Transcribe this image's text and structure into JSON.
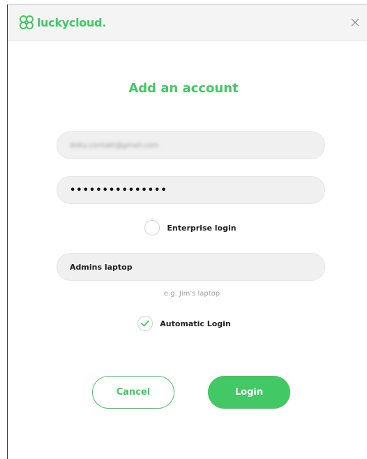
{
  "app": {
    "brand": "luckycloud",
    "brand_color": "#42c864"
  },
  "dialog": {
    "title": "Add an account",
    "email_value": "doku.contakt@gmail.com",
    "password_value": "•••••••••••••••",
    "enterprise_label": "Enterprise login",
    "enterprise_checked": false,
    "device_name_value": "Admins laptop",
    "device_name_hint": "e.g. Jim's laptop",
    "auto_login_label": "Automatic Login",
    "auto_login_checked": true,
    "cancel_label": "Cancel",
    "login_label": "Login"
  },
  "icons": {
    "logo": "luckycloud-logo-icon",
    "close": "close-icon",
    "check": "checkmark-icon"
  }
}
